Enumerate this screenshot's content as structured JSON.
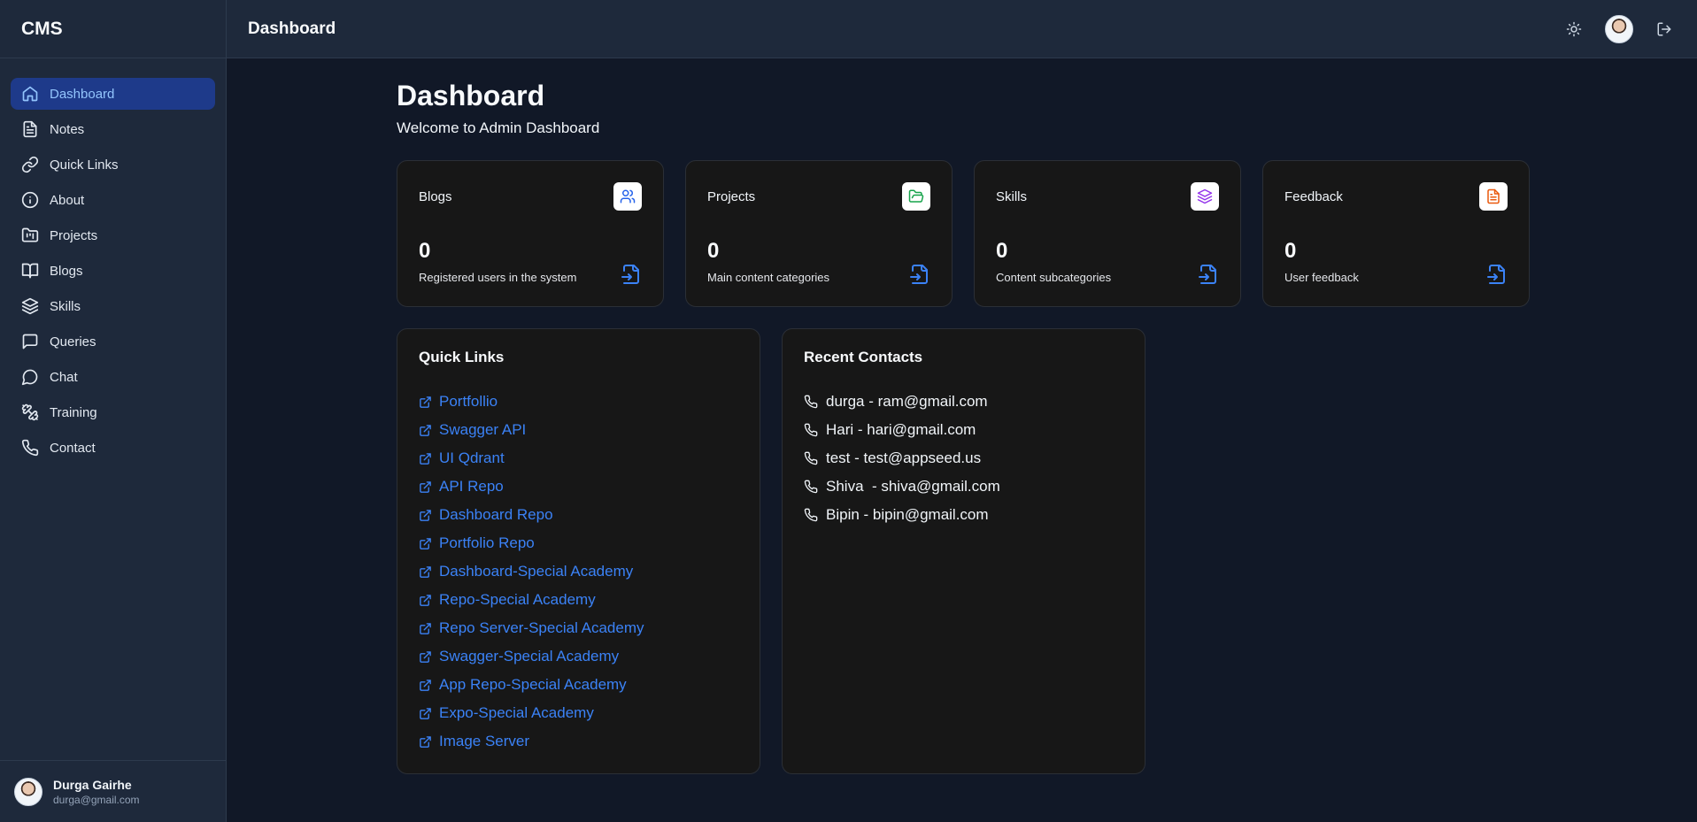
{
  "brand": "CMS",
  "header": {
    "title": "Dashboard"
  },
  "sidebar": {
    "items": [
      {
        "label": "Dashboard",
        "icon": "home-icon",
        "active": true
      },
      {
        "label": "Notes",
        "icon": "file-text-icon"
      },
      {
        "label": "Quick Links",
        "icon": "link-icon"
      },
      {
        "label": "About",
        "icon": "info-icon"
      },
      {
        "label": "Projects",
        "icon": "folder-kanban-icon"
      },
      {
        "label": "Blogs",
        "icon": "book-open-icon"
      },
      {
        "label": "Skills",
        "icon": "layers-icon"
      },
      {
        "label": "Queries",
        "icon": "message-square-icon"
      },
      {
        "label": "Chat",
        "icon": "message-circle-icon"
      },
      {
        "label": "Training",
        "icon": "dumbbell-icon"
      },
      {
        "label": "Contact",
        "icon": "phone-icon"
      }
    ],
    "user": {
      "name": "Durga Gairhe",
      "email": "durga@gmail.com"
    }
  },
  "main": {
    "title": "Dashboard",
    "subtitle": "Welcome to Admin Dashboard",
    "stats": [
      {
        "label": "Blogs",
        "value": "0",
        "description": "Registered users in the system",
        "icon": "users-icon",
        "icon_color": "#2563eb"
      },
      {
        "label": "Projects",
        "value": "0",
        "description": "Main content categories",
        "icon": "folder-open-icon",
        "icon_color": "#16a34a"
      },
      {
        "label": "Skills",
        "value": "0",
        "description": "Content subcategories",
        "icon": "layers-icon",
        "icon_color": "#9333ea"
      },
      {
        "label": "Feedback",
        "value": "0",
        "description": "User feedback",
        "icon": "file-text-icon",
        "icon_color": "#ea580c"
      }
    ],
    "quick_links": {
      "title": "Quick Links",
      "items": [
        "Portfollio",
        "Swagger API",
        "UI Qdrant",
        "API Repo",
        "Dashboard Repo",
        "Portfolio Repo",
        "Dashboard-Special Academy",
        "Repo-Special Academy",
        "Repo Server-Special Academy",
        "Swagger-Special Academy",
        "App Repo-Special Academy",
        "Expo-Special Academy",
        "Image Server"
      ]
    },
    "recent_contacts": {
      "title": "Recent Contacts",
      "items": [
        "durga - ram@gmail.com",
        "Hari - hari@gmail.com",
        "test - test@appseed.us",
        "Shiva  - shiva@gmail.com",
        "Bipin - bipin@gmail.com"
      ]
    }
  },
  "colors": {
    "accent": "#3b82f6",
    "active_nav_bg": "#1e3a8a",
    "page_bg": "#111827",
    "sidebar_bg": "#1e293b",
    "card_bg": "#171717"
  }
}
